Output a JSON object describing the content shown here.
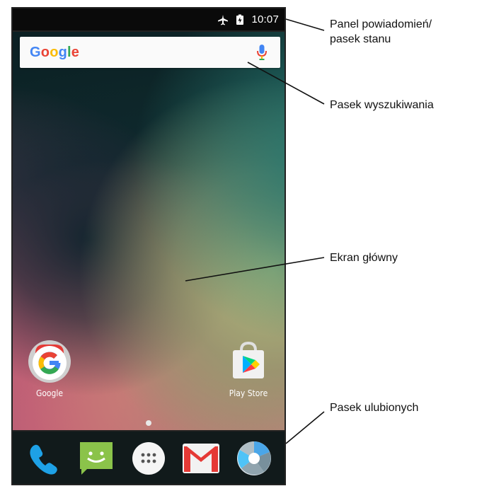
{
  "status_bar": {
    "time": "10:07",
    "icons": [
      "airplane-icon",
      "battery-charging-icon"
    ]
  },
  "search_bar": {
    "logo_text": [
      "G",
      "o",
      "o",
      "g",
      "l",
      "e"
    ],
    "logo_colors": [
      "#4285f4",
      "#ea4335",
      "#fbbc05",
      "#4285f4",
      "#34a853",
      "#ea4335"
    ],
    "icon": "mic-icon"
  },
  "home_apps": [
    {
      "label": "Google",
      "icon": "google-app-icon"
    },
    {
      "label": "Play Store",
      "icon": "play-store-icon"
    }
  ],
  "dock": {
    "icons": [
      "phone-icon",
      "messaging-icon",
      "app-drawer-icon",
      "gmail-icon",
      "camera-icon"
    ]
  },
  "callouts": {
    "status_bar_line1": "Panel powiadomień/",
    "status_bar_line2": "pasek stanu",
    "search_bar": "Pasek wyszukiwania",
    "home_screen": "Ekran główny",
    "favorites_bar": "Pasek ulubionych"
  }
}
